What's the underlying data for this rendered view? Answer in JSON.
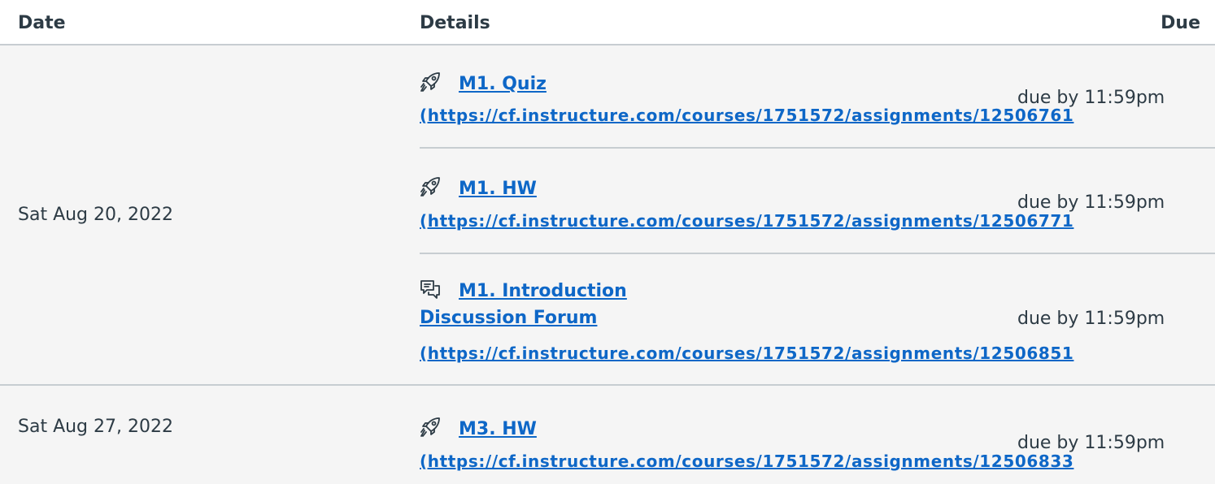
{
  "table": {
    "headers": {
      "date": "Date",
      "details": "Details",
      "due": "Due"
    },
    "groups": [
      {
        "date": "Sat Aug 20, 2022",
        "items": [
          {
            "icon": "rocket-icon",
            "title": "M1. Quiz",
            "url": "(https://cf.instructure.com/courses/1751572/assignments/12506761",
            "due": "due by 11:59pm"
          },
          {
            "icon": "rocket-icon",
            "title": "M1. HW",
            "url": "(https://cf.instructure.com/courses/1751572/assignments/12506771",
            "due": "due by 11:59pm"
          },
          {
            "icon": "discussion-icon",
            "title_line1": "M1. Introduction",
            "title_line2": "Discussion Forum",
            "url": "(https://cf.instructure.com/courses/1751572/assignments/12506851",
            "due": "due by 11:59pm"
          }
        ]
      },
      {
        "date": "Sat Aug 27, 2022",
        "items": [
          {
            "icon": "rocket-icon",
            "title": "M3. HW",
            "url": "(https://cf.instructure.com/courses/1751572/assignments/12506833",
            "due": "due by 11:59pm"
          }
        ]
      }
    ]
  },
  "colors": {
    "link": "#0e67c7",
    "text": "#2d3b45",
    "row_background": "#f5f5f5",
    "divider": "#c7cdd1"
  }
}
